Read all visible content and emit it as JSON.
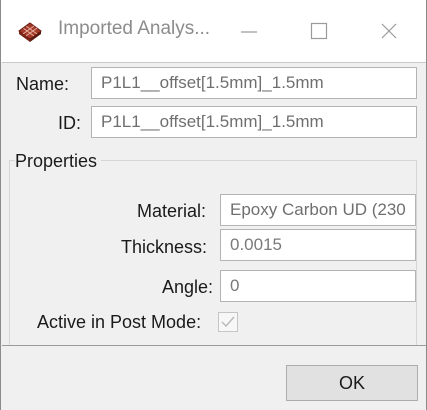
{
  "window": {
    "title": "Imported Analys...",
    "app_icon": "ply-layers-icon",
    "controls": {
      "minimize_icon": "minimize-icon",
      "maximize_icon": "maximize-icon",
      "close_icon": "close-icon"
    }
  },
  "form": {
    "name_label": "Name:",
    "name_value": "P1L1__offset[1.5mm]_1.5mm",
    "id_label": "ID:",
    "id_value": "P1L1__offset[1.5mm]_1.5mm"
  },
  "properties": {
    "group_title": "Properties",
    "material_label": "Material:",
    "material_value": "Epoxy Carbon UD (230",
    "thickness_label": "Thickness:",
    "thickness_value": "0.0015",
    "angle_label": "Angle:",
    "angle_value": "0",
    "active_label": "Active in Post Mode:",
    "active_checked": true
  },
  "buttons": {
    "ok_label": "OK"
  }
}
